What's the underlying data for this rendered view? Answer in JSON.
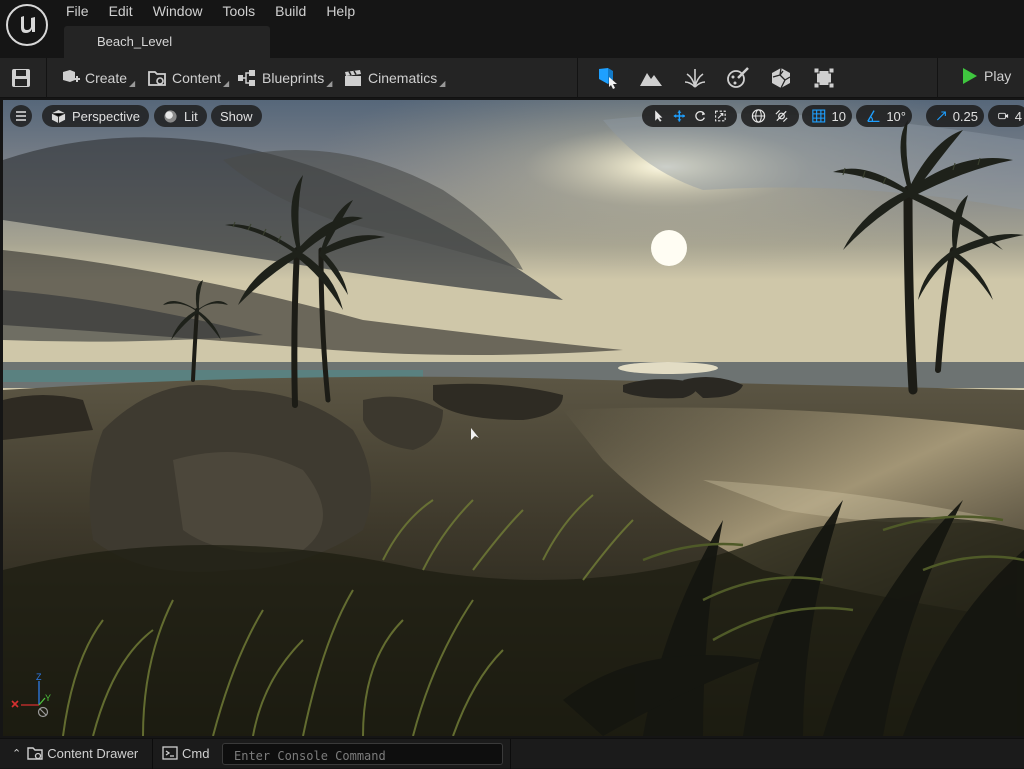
{
  "menu": [
    "File",
    "Edit",
    "Window",
    "Tools",
    "Build",
    "Help"
  ],
  "level_tab": "Beach_Level",
  "toolbar": {
    "create": "Create",
    "content": "Content",
    "blueprints": "Blueprints",
    "cinematics": "Cinematics",
    "play": "Play",
    "modes": [
      "select-mode-icon",
      "landscape-mode-icon",
      "foliage-mode-icon",
      "mesh-paint-mode-icon",
      "fracture-mode-icon",
      "modeling-mode-icon"
    ]
  },
  "viewport": {
    "view_mode": "Perspective",
    "lighting": "Lit",
    "show": "Show",
    "grid_snap": "10",
    "rotation_snap": "10°",
    "scale_snap": "0.25",
    "camera_speed": "4",
    "axis": {
      "z": "Z",
      "y": "Y"
    }
  },
  "statusbar": {
    "content_drawer": "Content Drawer",
    "cmd": "Cmd",
    "console_placeholder": "Enter Console Command"
  },
  "colors": {
    "accent_blue": "#1ea0ff",
    "play_green": "#3fc63f",
    "sky_light": "#b9b7a8",
    "sand": "#7a6f58"
  }
}
